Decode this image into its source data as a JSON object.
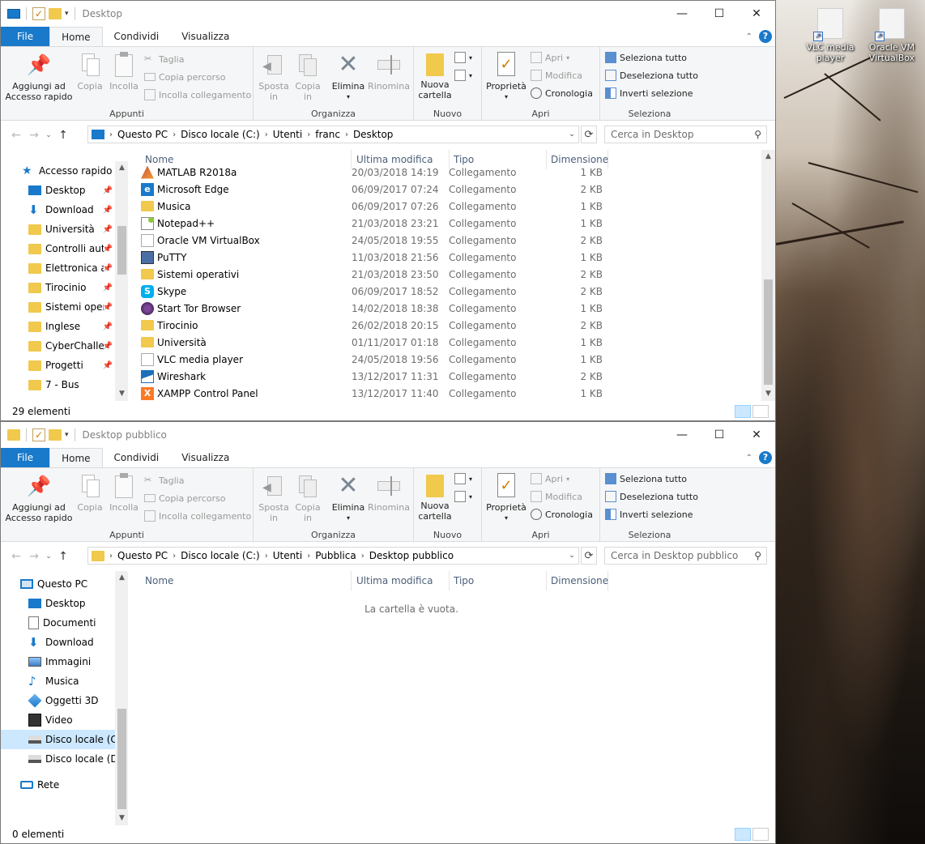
{
  "desktop": {
    "icons": [
      {
        "label": "VLC media player",
        "name": "desktop-icon-vlc"
      },
      {
        "label": "Oracle VM VirtualBox",
        "name": "desktop-icon-virtualbox"
      }
    ]
  },
  "window1": {
    "title": "Desktop",
    "tabs": [
      {
        "label": "File"
      },
      {
        "label": "Home"
      },
      {
        "label": "Condividi"
      },
      {
        "label": "Visualizza"
      }
    ],
    "ribbon": {
      "pin_label": "Aggiungi ad Accesso rapido",
      "copy_label": "Copia",
      "paste_label": "Incolla",
      "cut_label": "Taglia",
      "copy_path_label": "Copia percorso",
      "paste_link_label": "Incolla collegamento",
      "group_clipboard": "Appunti",
      "move_label": "Sposta in",
      "copyto_label": "Copia in",
      "delete_label": "Elimina",
      "rename_label": "Rinomina",
      "group_organize": "Organizza",
      "new_folder_label": "Nuova cartella",
      "group_new": "Nuovo",
      "properties_label": "Proprietà",
      "open_label": "Apri",
      "edit_label": "Modifica",
      "history_label": "Cronologia",
      "group_open": "Apri",
      "select_all_label": "Seleziona tutto",
      "select_none_label": "Deseleziona tutto",
      "invert_label": "Inverti selezione",
      "group_select": "Seleziona"
    },
    "breadcrumb": [
      "Questo PC",
      "Disco locale (C:)",
      "Utenti",
      "franc",
      "Desktop"
    ],
    "search_placeholder": "Cerca in Desktop",
    "nav": [
      {
        "label": "Accesso rapido",
        "icon": "star-icon",
        "pinned": false
      },
      {
        "label": "Desktop",
        "icon": "desktop-icon",
        "pinned": true
      },
      {
        "label": "Download",
        "icon": "download-icon",
        "pinned": true
      },
      {
        "label": "Università",
        "icon": "folder-icon",
        "pinned": true
      },
      {
        "label": "Controlli automatici",
        "icon": "folder-icon",
        "pinned": true
      },
      {
        "label": "Elettronica applicata",
        "icon": "folder-icon",
        "pinned": true
      },
      {
        "label": "Tirocinio",
        "icon": "folder-icon",
        "pinned": true
      },
      {
        "label": "Sistemi operativi",
        "icon": "folder-icon",
        "pinned": true
      },
      {
        "label": "Inglese",
        "icon": "folder-icon",
        "pinned": true
      },
      {
        "label": "CyberChallenge",
        "icon": "folder-icon",
        "pinned": true
      },
      {
        "label": "Progetti",
        "icon": "folder-icon",
        "pinned": true
      },
      {
        "label": "7 - Bus",
        "icon": "folder-icon",
        "pinned": false
      }
    ],
    "columns": {
      "name": "Nome",
      "date": "Ultima modifica",
      "type": "Tipo",
      "size": "Dimensione"
    },
    "files": [
      {
        "name": "MATLAB R2018a",
        "date": "20/03/2018 14:19",
        "type": "Collegamento",
        "size": "1 KB",
        "icon": "matlab-icon"
      },
      {
        "name": "Microsoft Edge",
        "date": "06/09/2017 07:24",
        "type": "Collegamento",
        "size": "2 KB",
        "icon": "edge-icon"
      },
      {
        "name": "Musica",
        "date": "06/09/2017 07:26",
        "type": "Collegamento",
        "size": "1 KB",
        "icon": "folder-shortcut-icon"
      },
      {
        "name": "Notepad++",
        "date": "21/03/2018 23:21",
        "type": "Collegamento",
        "size": "1 KB",
        "icon": "notepadpp-icon"
      },
      {
        "name": "Oracle VM VirtualBox",
        "date": "24/05/2018 19:55",
        "type": "Collegamento",
        "size": "2 KB",
        "icon": "shortcut-icon"
      },
      {
        "name": "PuTTY",
        "date": "11/03/2018 21:56",
        "type": "Collegamento",
        "size": "1 KB",
        "icon": "putty-icon"
      },
      {
        "name": "Sistemi operativi",
        "date": "21/03/2018 23:50",
        "type": "Collegamento",
        "size": "2 KB",
        "icon": "folder-shortcut-icon"
      },
      {
        "name": "Skype",
        "date": "06/09/2017 18:52",
        "type": "Collegamento",
        "size": "2 KB",
        "icon": "skype-icon"
      },
      {
        "name": "Start Tor Browser",
        "date": "14/02/2018 18:38",
        "type": "Collegamento",
        "size": "1 KB",
        "icon": "tor-icon"
      },
      {
        "name": "Tirocinio",
        "date": "26/02/2018 20:15",
        "type": "Collegamento",
        "size": "2 KB",
        "icon": "folder-shortcut-icon"
      },
      {
        "name": "Università",
        "date": "01/11/2017 01:18",
        "type": "Collegamento",
        "size": "1 KB",
        "icon": "folder-shortcut-icon"
      },
      {
        "name": "VLC media player",
        "date": "24/05/2018 19:56",
        "type": "Collegamento",
        "size": "1 KB",
        "icon": "shortcut-icon"
      },
      {
        "name": "Wireshark",
        "date": "13/12/2017 11:31",
        "type": "Collegamento",
        "size": "2 KB",
        "icon": "wireshark-icon"
      },
      {
        "name": "XAMPP Control Panel",
        "date": "13/12/2017 11:40",
        "type": "Collegamento",
        "size": "1 KB",
        "icon": "xampp-icon"
      }
    ],
    "status": "29 elementi"
  },
  "window2": {
    "title": "Desktop pubblico",
    "breadcrumb": [
      "Questo PC",
      "Disco locale (C:)",
      "Utenti",
      "Pubblica",
      "Desktop pubblico"
    ],
    "search_placeholder": "Cerca in Desktop pubblico",
    "nav": [
      {
        "label": "Questo PC",
        "icon": "pc-icon"
      },
      {
        "label": "Desktop",
        "icon": "desktop-icon"
      },
      {
        "label": "Documenti",
        "icon": "documents-icon"
      },
      {
        "label": "Download",
        "icon": "download-icon"
      },
      {
        "label": "Immagini",
        "icon": "pictures-icon"
      },
      {
        "label": "Musica",
        "icon": "music-icon"
      },
      {
        "label": "Oggetti 3D",
        "icon": "objects3d-icon"
      },
      {
        "label": "Video",
        "icon": "video-icon"
      },
      {
        "label": "Disco locale (C:)",
        "icon": "drive-c-icon"
      },
      {
        "label": "Disco locale (D:)",
        "icon": "drive-d-icon"
      },
      {
        "label": "Rete",
        "icon": "network-icon"
      }
    ],
    "empty_message": "La cartella è vuota.",
    "status": "0 elementi"
  },
  "colors": {
    "accent": "#1979ca",
    "selection": "#cce8ff",
    "folder": "#f0c94d",
    "header_text": "#4c607a"
  }
}
